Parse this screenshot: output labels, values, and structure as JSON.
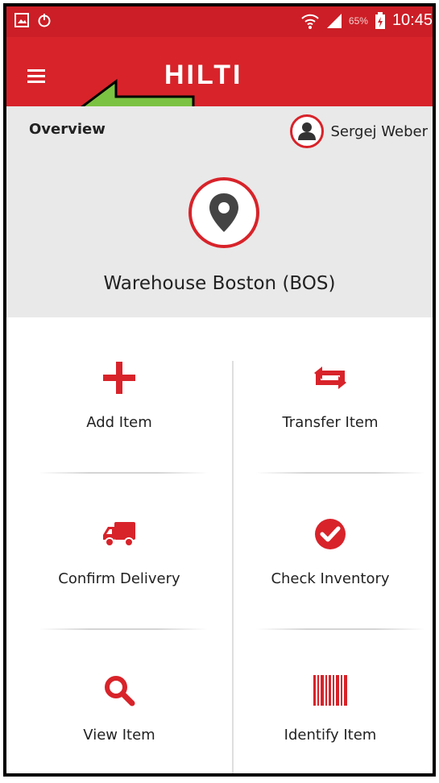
{
  "status_bar": {
    "battery_percent": "65%",
    "time": "10:45"
  },
  "app_bar": {
    "logo_text": "HILTI"
  },
  "overview": {
    "title": "Overview",
    "user_name": "Sergej Weber",
    "location": "Warehouse Boston (BOS)"
  },
  "actions": [
    {
      "label": "Add Item",
      "icon": "plus-icon"
    },
    {
      "label": "Transfer Item",
      "icon": "transfer-icon"
    },
    {
      "label": "Confirm Delivery",
      "icon": "truck-icon"
    },
    {
      "label": "Check Inventory",
      "icon": "check-circle-icon"
    },
    {
      "label": "View Item",
      "icon": "search-icon"
    },
    {
      "label": "Identify Item",
      "icon": "barcode-icon"
    }
  ],
  "colors": {
    "brand_red": "#d8232a",
    "arrow_green": "#7cc242"
  }
}
